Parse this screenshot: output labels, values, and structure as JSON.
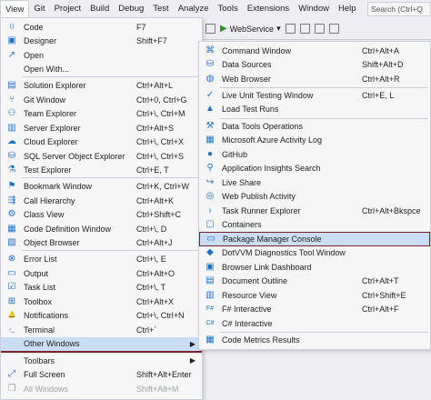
{
  "menubar": {
    "items": [
      "View",
      "Git",
      "Project",
      "Build",
      "Debug",
      "Test",
      "Analyze",
      "Tools",
      "Extensions",
      "Window",
      "Help"
    ],
    "search_placeholder": "Search (Ctrl+Q"
  },
  "toolbar": {
    "webservice_label": "WebService",
    "dropdown_arrow": "▾"
  },
  "view_menu": {
    "items": [
      {
        "icon": "code-icon",
        "glyph": "⟨⟩",
        "label": "Code",
        "shortcut": "F7"
      },
      {
        "icon": "designer-icon",
        "glyph": "▣",
        "label": "Designer",
        "shortcut": "Shift+F7"
      },
      {
        "icon": "open-icon",
        "glyph": "↗",
        "label": "Open",
        "shortcut": ""
      },
      {
        "icon": "",
        "glyph": "",
        "label": "Open With...",
        "shortcut": ""
      },
      {
        "icon": "solution-explorer-icon",
        "glyph": "▤",
        "label": "Solution Explorer",
        "shortcut": "Ctrl+Alt+L"
      },
      {
        "icon": "git-icon",
        "glyph": "⑂",
        "label": "Git Window",
        "shortcut": "Ctrl+0, Ctrl+G"
      },
      {
        "icon": "team-explorer-icon",
        "glyph": "⚇",
        "label": "Team Explorer",
        "shortcut": "Ctrl+\\, Ctrl+M"
      },
      {
        "icon": "server-explorer-icon",
        "glyph": "▥",
        "label": "Server Explorer",
        "shortcut": "Ctrl+Alt+S"
      },
      {
        "icon": "cloud-icon",
        "glyph": "☁",
        "label": "Cloud Explorer",
        "shortcut": "Ctrl+\\, Ctrl+X"
      },
      {
        "icon": "sql-icon",
        "glyph": "⛁",
        "label": "SQL Server Object Explorer",
        "shortcut": "Ctrl+\\, Ctrl+S"
      },
      {
        "icon": "test-explorer-icon",
        "glyph": "⚗",
        "label": "Test Explorer",
        "shortcut": "Ctrl+E, T"
      },
      {
        "icon": "bookmark-icon",
        "glyph": "⚑",
        "label": "Bookmark Window",
        "shortcut": "Ctrl+K, Ctrl+W"
      },
      {
        "icon": "call-hierarchy-icon",
        "glyph": "⇶",
        "label": "Call Hierarchy",
        "shortcut": "Ctrl+Alt+K"
      },
      {
        "icon": "class-view-icon",
        "glyph": "⚙",
        "label": "Class View",
        "shortcut": "Ctrl+Shift+C"
      },
      {
        "icon": "code-definition-icon",
        "glyph": "▦",
        "label": "Code Definition Window",
        "shortcut": "Ctrl+\\, D"
      },
      {
        "icon": "object-browser-icon",
        "glyph": "▧",
        "label": "Object Browser",
        "shortcut": "Ctrl+Alt+J"
      },
      {
        "icon": "error-list-icon",
        "glyph": "⊗",
        "label": "Error List",
        "shortcut": "Ctrl+\\, E"
      },
      {
        "icon": "output-icon",
        "glyph": "▭",
        "label": "Output",
        "shortcut": "Ctrl+Alt+O"
      },
      {
        "icon": "task-list-icon",
        "glyph": "☑",
        "label": "Task List",
        "shortcut": "Ctrl+\\, T"
      },
      {
        "icon": "toolbox-icon",
        "glyph": "⊞",
        "label": "Toolbox",
        "shortcut": "Ctrl+Alt+X"
      },
      {
        "icon": "notifications-icon",
        "glyph": "🔔",
        "label": "Notifications",
        "shortcut": "Ctrl+\\, Ctrl+N"
      },
      {
        "icon": "terminal-icon",
        "glyph": "›_",
        "label": "Terminal",
        "shortcut": "Ctrl+`"
      },
      {
        "icon": "",
        "glyph": "",
        "label": "Other Windows",
        "shortcut": "",
        "submenu": true
      },
      {
        "icon": "",
        "glyph": "",
        "label": "Toolbars",
        "shortcut": "",
        "submenu": true
      },
      {
        "icon": "full-screen-icon",
        "glyph": "⤢",
        "label": "Full Screen",
        "shortcut": "Shift+Alt+Enter"
      },
      {
        "icon": "all-windows-icon",
        "glyph": "❐",
        "label": "All Windows",
        "shortcut": "Shift+Alt+M",
        "disabled": true
      }
    ]
  },
  "other_windows_menu": {
    "items": [
      {
        "icon": "command-window-icon",
        "glyph": "⌘",
        "label": "Command Window",
        "shortcut": "Ctrl+Alt+A"
      },
      {
        "icon": "data-sources-icon",
        "glyph": "⛁",
        "label": "Data Sources",
        "shortcut": "Shift+Alt+D"
      },
      {
        "icon": "web-browser-icon",
        "glyph": "◍",
        "label": "Web Browser",
        "shortcut": "Ctrl+Alt+R"
      },
      {
        "icon": "live-unit-testing-icon",
        "glyph": "✓",
        "label": "Live Unit Testing Window",
        "shortcut": "Ctrl+E, L"
      },
      {
        "icon": "load-test-icon",
        "glyph": "▲",
        "label": "Load Test Runs",
        "shortcut": ""
      },
      {
        "icon": "data-tools-icon",
        "glyph": "⚒",
        "label": "Data Tools Operations",
        "shortcut": ""
      },
      {
        "icon": "azure-log-icon",
        "glyph": "▦",
        "label": "Microsoft Azure Activity Log",
        "shortcut": ""
      },
      {
        "icon": "github-icon",
        "glyph": "●",
        "label": "GitHub",
        "shortcut": ""
      },
      {
        "icon": "app-insights-icon",
        "glyph": "⚲",
        "label": "Application Insights Search",
        "shortcut": ""
      },
      {
        "icon": "live-share-icon",
        "glyph": "↪",
        "label": "Live Share",
        "shortcut": ""
      },
      {
        "icon": "web-publish-icon",
        "glyph": "◎",
        "label": "Web Publish Activity",
        "shortcut": ""
      },
      {
        "icon": "task-runner-icon",
        "glyph": "›",
        "label": "Task Runner Explorer",
        "shortcut": "Ctrl+Alt+Bkspce"
      },
      {
        "icon": "containers-icon",
        "glyph": "▢",
        "label": "Containers",
        "shortcut": ""
      },
      {
        "icon": "package-manager-icon",
        "glyph": "▭",
        "label": "Package Manager Console",
        "shortcut": "",
        "highlighted": true
      },
      {
        "icon": "dotvvm-icon",
        "glyph": "◆",
        "label": "DotVVM Diagnostics Tool Window",
        "shortcut": ""
      },
      {
        "icon": "browser-link-icon",
        "glyph": "▣",
        "label": "Browser Link Dashboard",
        "shortcut": ""
      },
      {
        "icon": "document-outline-icon",
        "glyph": "▤",
        "label": "Document Outline",
        "shortcut": "Ctrl+Alt+T"
      },
      {
        "icon": "resource-view-icon",
        "glyph": "▥",
        "label": "Resource View",
        "shortcut": "Ctrl+Shift+E"
      },
      {
        "icon": "fsharp-icon",
        "glyph": "F#",
        "label": "F# Interactive",
        "shortcut": "Ctrl+Alt+F"
      },
      {
        "icon": "csharp-icon",
        "glyph": "C#",
        "label": "C# Interactive",
        "shortcut": ""
      },
      {
        "icon": "code-metrics-icon",
        "glyph": "▦",
        "label": "Code Metrics Results",
        "shortcut": ""
      }
    ]
  },
  "colors": {
    "highlight_border": "#7a1f2b",
    "highlight_fill": "#c9def5",
    "icon_blue": "#1e6fc6"
  }
}
